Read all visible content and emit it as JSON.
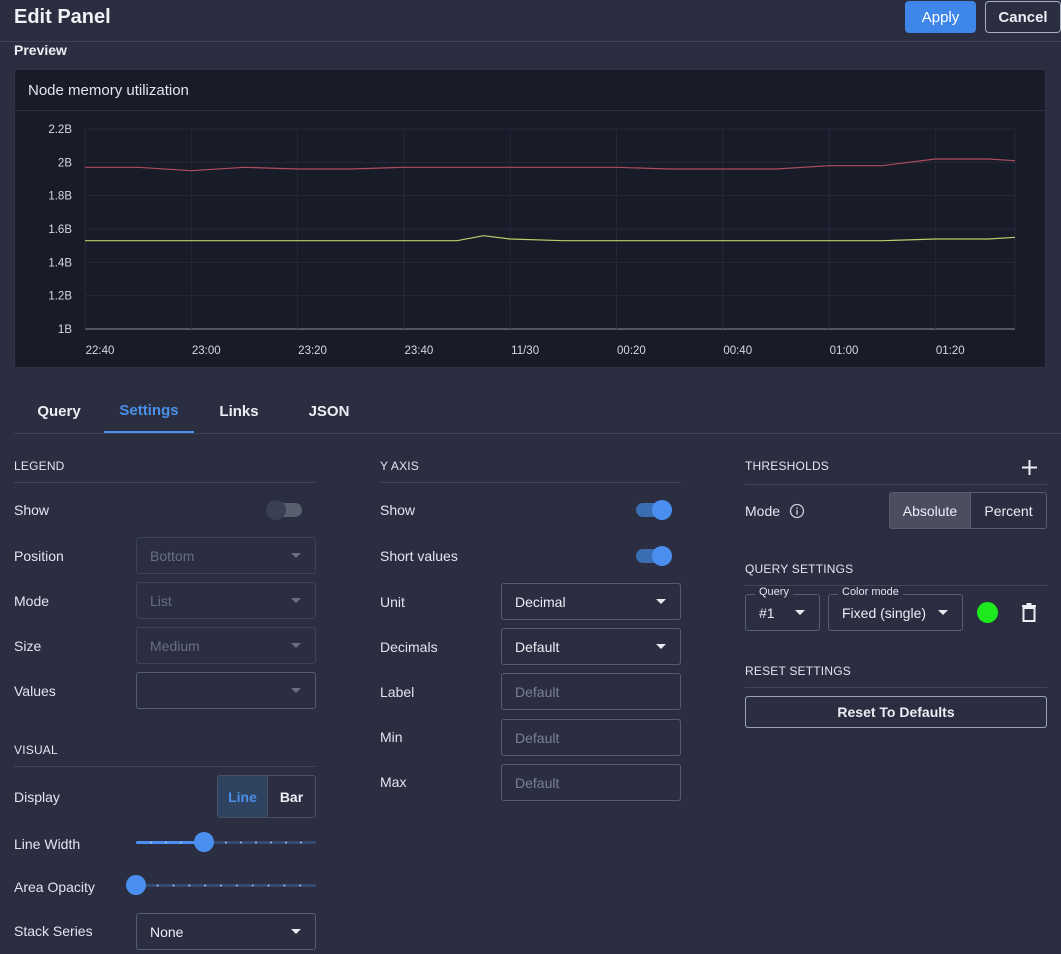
{
  "header": {
    "title": "Edit Panel",
    "apply_label": "Apply",
    "cancel_label": "Cancel"
  },
  "preview": {
    "label": "Preview",
    "panel_title": "Node memory utilization"
  },
  "chart_data": {
    "type": "line",
    "title": "Node memory utilization",
    "x_ticks": [
      "22:40",
      "23:00",
      "23:20",
      "23:40",
      "11/30",
      "00:20",
      "00:40",
      "01:00",
      "01:20"
    ],
    "y_ticks": [
      "1B",
      "1.2B",
      "1.4B",
      "1.6B",
      "1.8B",
      "2B",
      "2.2B"
    ],
    "ylim": [
      1.0,
      2.2
    ],
    "grid": true,
    "legend": "hidden",
    "series": [
      {
        "color": "#b04c5e",
        "x": [
          "22:40",
          "22:50",
          "23:00",
          "23:10",
          "23:20",
          "23:30",
          "23:40",
          "23:50",
          "00:00",
          "00:10",
          "00:20",
          "00:30",
          "00:40",
          "00:50",
          "01:00",
          "01:10",
          "01:20",
          "01:30",
          "01:35"
        ],
        "values": [
          1.97,
          1.97,
          1.95,
          1.97,
          1.96,
          1.96,
          1.97,
          1.97,
          1.97,
          1.97,
          1.97,
          1.96,
          1.96,
          1.96,
          1.98,
          1.98,
          2.02,
          2.02,
          2.01
        ]
      },
      {
        "color": "#b8d06a",
        "x": [
          "22:40",
          "22:50",
          "23:00",
          "23:10",
          "23:20",
          "23:30",
          "23:40",
          "23:50",
          "23:55",
          "00:00",
          "00:10",
          "00:20",
          "00:30",
          "00:40",
          "00:50",
          "01:00",
          "01:10",
          "01:20",
          "01:30",
          "01:35"
        ],
        "values": [
          1.53,
          1.53,
          1.53,
          1.53,
          1.53,
          1.53,
          1.53,
          1.53,
          1.56,
          1.54,
          1.53,
          1.53,
          1.53,
          1.53,
          1.53,
          1.53,
          1.53,
          1.54,
          1.54,
          1.55
        ]
      }
    ]
  },
  "tabs": [
    "Query",
    "Settings",
    "Links",
    "JSON"
  ],
  "active_tab": "Settings",
  "legend": {
    "title": "LEGEND",
    "show_label": "Show",
    "show_on": false,
    "position_label": "Position",
    "position_value": "Bottom",
    "mode_label": "Mode",
    "mode_value": "List",
    "size_label": "Size",
    "size_value": "Medium",
    "values_label": "Values",
    "values_value": ""
  },
  "visual": {
    "title": "VISUAL",
    "display_label": "Display",
    "display_options": [
      "Line",
      "Bar"
    ],
    "display_selected": "Line",
    "line_width_label": "Line Width",
    "line_width_level": 0.36,
    "area_opacity_label": "Area Opacity",
    "area_opacity_level": 0,
    "stack_label": "Stack Series",
    "stack_value": "None"
  },
  "y_axis": {
    "title": "Y AXIS",
    "show_label": "Show",
    "show_on": true,
    "short_label": "Short values",
    "short_on": true,
    "unit_label": "Unit",
    "unit_value": "Decimal",
    "decimals_label": "Decimals",
    "decimals_value": "Default",
    "label_label": "Label",
    "label_placeholder": "Default",
    "min_label": "Min",
    "min_placeholder": "Default",
    "max_label": "Max",
    "max_placeholder": "Default"
  },
  "thresholds": {
    "title": "THRESHOLDS",
    "mode_label": "Mode",
    "mode_options": [
      "Absolute",
      "Percent"
    ],
    "mode_selected": "Absolute"
  },
  "query_settings": {
    "title": "QUERY SETTINGS",
    "query_legend": "Query",
    "query_value": "#1",
    "color_mode_legend": "Color mode",
    "color_mode_value": "Fixed (single)",
    "color": "#1ee81e"
  },
  "reset": {
    "title": "RESET SETTINGS",
    "button_label": "Reset To Defaults"
  },
  "colors": {
    "accent": "#3e86e8",
    "background": "#2a2e40",
    "panel": "#181b28"
  }
}
